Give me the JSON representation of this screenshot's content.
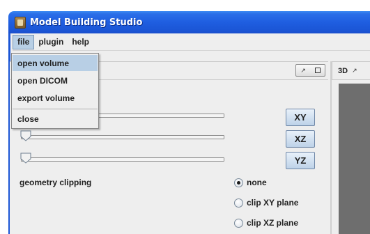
{
  "window": {
    "title": "Model Building Studio",
    "icon": "app-icon"
  },
  "menubar": {
    "items": [
      {
        "label": "file"
      },
      {
        "label": "plugin"
      },
      {
        "label": "help"
      }
    ]
  },
  "file_menu": {
    "items": [
      {
        "label": "open volume",
        "highlighted": true
      },
      {
        "label": "open DICOM"
      },
      {
        "label": "export volume"
      },
      {
        "label": "close"
      }
    ]
  },
  "slice_panel": {
    "plane_buttons": [
      {
        "label": "XY"
      },
      {
        "label": "XZ"
      },
      {
        "label": "YZ"
      }
    ],
    "clipping": {
      "label": "geometry clipping",
      "options": [
        {
          "label": "none",
          "checked": true
        },
        {
          "label": "clip XY plane",
          "checked": false
        },
        {
          "label": "clip XZ plane",
          "checked": false
        }
      ]
    }
  },
  "view_3d": {
    "tab_label": "3D"
  },
  "colors": {
    "titlebar": "#1f5ee0",
    "menu_highlight": "#b8cfe5",
    "viewport_bg": "#6e6e6e"
  }
}
